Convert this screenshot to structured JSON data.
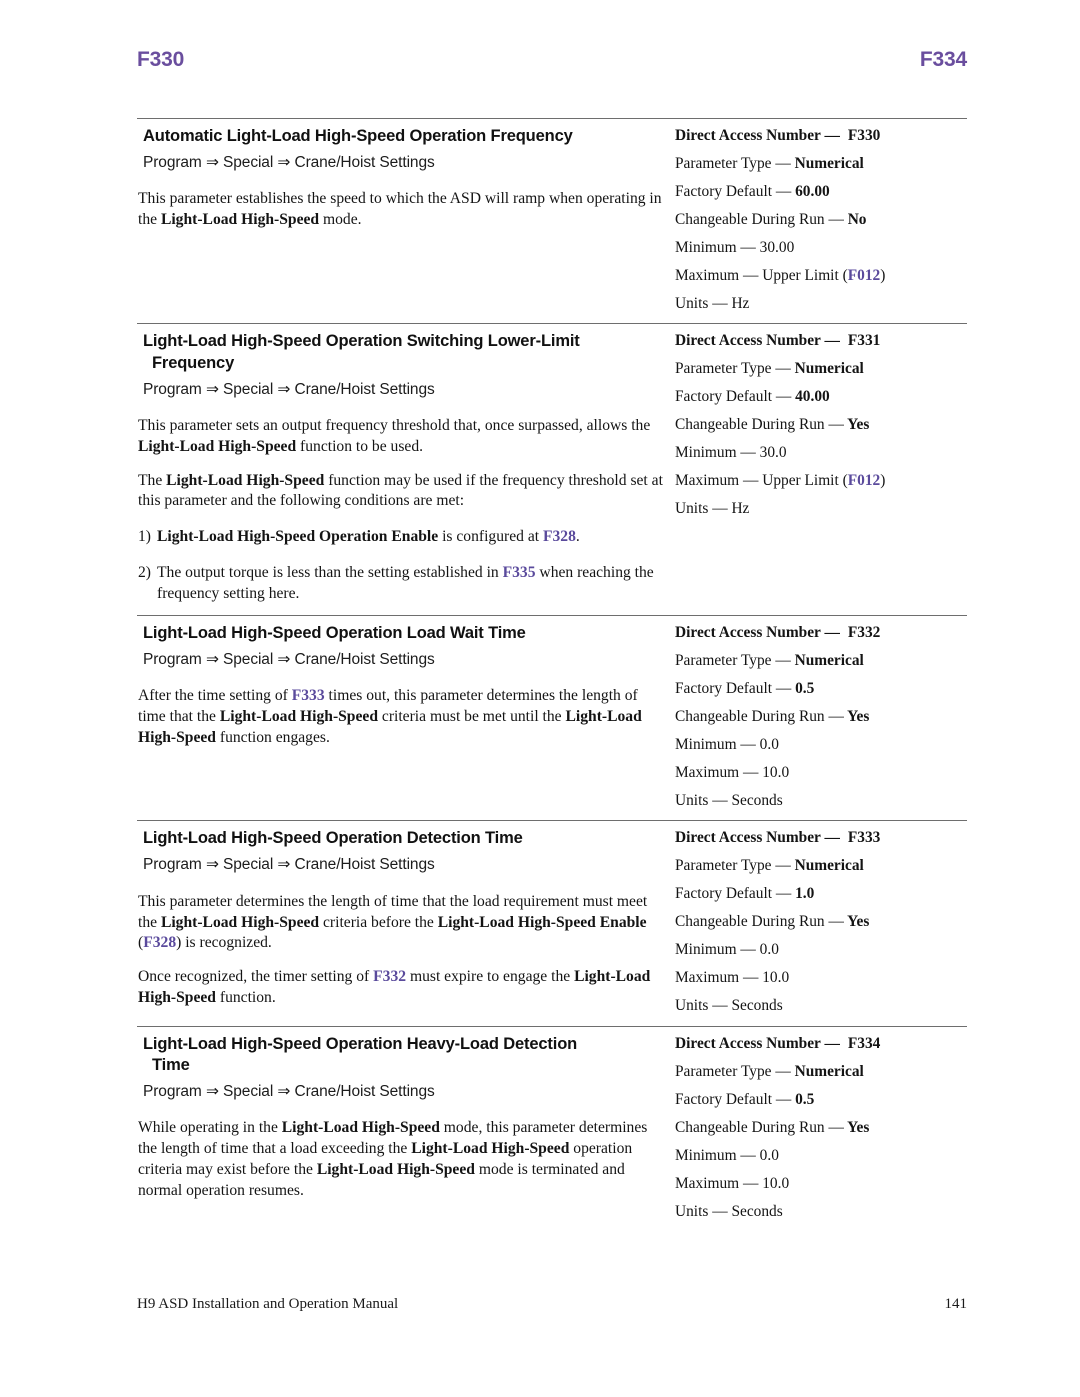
{
  "running_head": {
    "left": "F330",
    "right": "F334",
    "color": "#6a4e9e"
  },
  "footer": {
    "manual_title": "H9 ASD Installation and Operation Manual",
    "page_number": "141"
  },
  "spec_labels": {
    "direct_access_number": "Direct Access Number —",
    "parameter_type": "Parameter Type —",
    "factory_default": "Factory Default —",
    "changeable_during_run": "Changeable During Run —",
    "minimum": "Minimum —",
    "maximum": "Maximum —",
    "units": "Units —"
  },
  "sections": [
    {
      "title": "Automatic Light-Load High-Speed Operation Frequency",
      "title_cont": "",
      "path": "Program ⇒ Special ⇒ Crane/Hoist Settings",
      "paragraphs": [
        "This parameter establishes the speed to which the ASD will ramp when operating in the Light-Load High-Speed mode."
      ],
      "spec": {
        "direct_access_number": "F330",
        "parameter_type": "Numerical",
        "factory_default": "60.00",
        "changeable_during_run": "No",
        "minimum": "30.00",
        "maximum": "Upper Limit (F012)",
        "maximum_ref": "F012",
        "units": "Hz"
      }
    },
    {
      "title": "Light-Load High-Speed Operation Switching Lower-Limit",
      "title_cont": "Frequency",
      "path": "Program ⇒ Special ⇒ Crane/Hoist Settings",
      "paragraphs": [
        "This parameter sets an output frequency threshold that, once surpassed, allows the Light-Load High-Speed function to be used.",
        "The Light-Load High-Speed function may be used if the frequency threshold set at this parameter and the following conditions are met:"
      ],
      "numbered": [
        {
          "marker": "1)",
          "text": "Light-Load High-Speed Operation Enable is configured at F328."
        },
        {
          "marker": "2)",
          "text": "The output torque is less than the setting established in F335 when reaching the frequency setting here."
        }
      ],
      "spec": {
        "direct_access_number": "F331",
        "parameter_type": "Numerical",
        "factory_default": "40.00",
        "changeable_during_run": "Yes",
        "minimum": "30.0",
        "maximum": "Upper Limit (F012)",
        "maximum_ref": "F012",
        "units": "Hz"
      }
    },
    {
      "title": "Light-Load High-Speed Operation Load Wait Time",
      "title_cont": "",
      "path": "Program ⇒ Special ⇒ Crane/Hoist Settings",
      "paragraphs": [
        "After the time setting of F333 times out, this parameter determines the length of time that the Light-Load High-Speed criteria must be met until the Light-Load High-Speed function engages."
      ],
      "spec": {
        "direct_access_number": "F332",
        "parameter_type": "Numerical",
        "factory_default": "0.5",
        "changeable_during_run": "Yes",
        "minimum": "0.0",
        "maximum": "10.0",
        "units": "Seconds"
      }
    },
    {
      "title": "Light-Load High-Speed Operation Detection Time",
      "title_cont": "",
      "path": "Program ⇒ Special ⇒ Crane/Hoist Settings",
      "paragraphs": [
        "This parameter determines the length of time that the load requirement must meet the Light-Load High-Speed criteria before the Light-Load High-Speed Enable (F328) is recognized.",
        "Once recognized, the timer setting of F332 must expire to engage the Light-Load High-Speed function."
      ],
      "spec": {
        "direct_access_number": "F333",
        "parameter_type": "Numerical",
        "factory_default": "1.0",
        "changeable_during_run": "Yes",
        "minimum": "0.0",
        "maximum": "10.0",
        "units": "Seconds"
      }
    },
    {
      "title": "Light-Load High-Speed Operation Heavy-Load Detection",
      "title_cont": "Time",
      "path": "Program ⇒ Special ⇒ Crane/Hoist Settings",
      "paragraphs": [
        "While operating in the Light-Load High-Speed mode, this parameter determines the length of time that a load exceeding the Light-Load High-Speed operation criteria may exist before the Light-Load High-Speed mode is terminated and normal operation resumes."
      ],
      "spec": {
        "direct_access_number": "F334",
        "parameter_type": "Numerical",
        "factory_default": "0.5",
        "changeable_during_run": "Yes",
        "minimum": "0.0",
        "maximum": "10.0",
        "units": "Seconds"
      }
    }
  ],
  "rich_text": {
    "sec0_p0": [
      {
        "t": "This parameter establishes the speed to which the ASD will ramp when operating in the ",
        "s": "n"
      },
      {
        "t": "Light-Load High-Speed",
        "s": "b"
      },
      {
        "t": " mode.",
        "s": "n"
      }
    ],
    "sec1_p0": [
      {
        "t": "This parameter sets an output frequency threshold that, once surpassed, allows the ",
        "s": "n"
      },
      {
        "t": "Light-Load High-Speed",
        "s": "b"
      },
      {
        "t": " function to be used.",
        "s": "n"
      }
    ],
    "sec1_p1": [
      {
        "t": "The ",
        "s": "n"
      },
      {
        "t": "Light-Load High-Speed",
        "s": "b"
      },
      {
        "t": " function may be used if the frequency threshold set at this parameter and the following conditions are met:",
        "s": "n"
      }
    ],
    "sec1_n0": [
      {
        "t": "Light-Load High-Speed Operation Enable",
        "s": "b"
      },
      {
        "t": " is configured at ",
        "s": "n"
      },
      {
        "t": "F328",
        "s": "r"
      },
      {
        "t": ".",
        "s": "n"
      }
    ],
    "sec1_n1": [
      {
        "t": "The output torque is less than the setting established in ",
        "s": "n"
      },
      {
        "t": "F335",
        "s": "r"
      },
      {
        "t": " when reaching the frequency setting here.",
        "s": "n"
      }
    ],
    "sec2_p0": [
      {
        "t": "After the time setting of ",
        "s": "n"
      },
      {
        "t": "F333",
        "s": "r"
      },
      {
        "t": " times out, this parameter determines the length of time that the ",
        "s": "n"
      },
      {
        "t": "Light-Load High-Speed",
        "s": "b"
      },
      {
        "t": " criteria must be met until the ",
        "s": "n"
      },
      {
        "t": "Light-Load High-Speed",
        "s": "b"
      },
      {
        "t": " function engages.",
        "s": "n"
      }
    ],
    "sec3_p0": [
      {
        "t": "This parameter determines the length of time that the load requirement must meet the ",
        "s": "n"
      },
      {
        "t": "Light-Load High-Speed",
        "s": "b"
      },
      {
        "t": " criteria before the ",
        "s": "n"
      },
      {
        "t": "Light-Load High-Speed Enable",
        "s": "b"
      },
      {
        "t": " (",
        "s": "n"
      },
      {
        "t": "F328",
        "s": "r"
      },
      {
        "t": ") is recognized.",
        "s": "n"
      }
    ],
    "sec3_p1": [
      {
        "t": "Once recognized, the timer setting of ",
        "s": "n"
      },
      {
        "t": "F332",
        "s": "r"
      },
      {
        "t": " must expire to engage the ",
        "s": "n"
      },
      {
        "t": "Light-Load High-Speed",
        "s": "b"
      },
      {
        "t": " function.",
        "s": "n"
      }
    ],
    "sec4_p0": [
      {
        "t": "While operating in the ",
        "s": "n"
      },
      {
        "t": "Light-Load High-Speed",
        "s": "b"
      },
      {
        "t": " mode, this parameter determines the length of time that a load exceeding the ",
        "s": "n"
      },
      {
        "t": "Light-Load High-Speed",
        "s": "b"
      },
      {
        "t": " operation criteria may exist before the ",
        "s": "n"
      },
      {
        "t": "Light-Load High-Speed",
        "s": "b"
      },
      {
        "t": " mode is terminated and normal operation resumes.",
        "s": "n"
      }
    ]
  }
}
